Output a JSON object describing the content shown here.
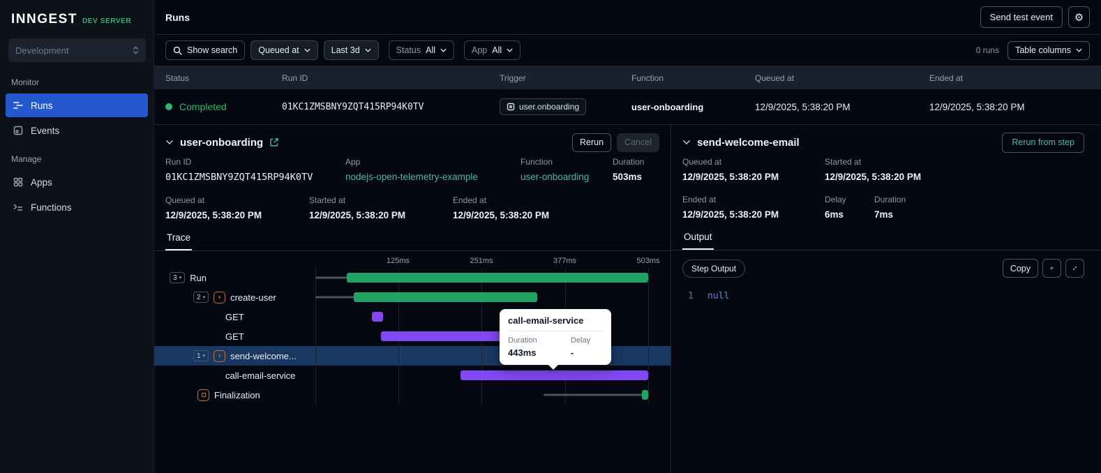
{
  "colors": {
    "green": "#2FB573",
    "bar_green": "#1FA463",
    "purple": "#8147F0",
    "teal": "#4CB7AA",
    "blue": "#2558CC",
    "selected_row": "#183761",
    "orange": "#C9722E"
  },
  "sidebar": {
    "logo": "INNGEST",
    "logo_badge": "DEV SERVER",
    "env_selector": "Development",
    "section_monitor": "Monitor",
    "section_manage": "Manage",
    "item_runs": "Runs",
    "item_events": "Events",
    "item_apps": "Apps",
    "item_functions": "Functions"
  },
  "header": {
    "title": "Runs",
    "send_test_event": "Send test event"
  },
  "filters": {
    "show_search": "Show search",
    "queued_at": "Queued at",
    "time_range": "Last 3d",
    "status_label": "Status",
    "status_value": "All",
    "app_label": "App",
    "app_value": "All",
    "runs_count": "0 runs",
    "table_columns": "Table columns"
  },
  "table": {
    "columns": [
      "Status",
      "Run ID",
      "Trigger",
      "Function",
      "Queued at",
      "Ended at"
    ],
    "row": {
      "status": "Completed",
      "run_id": "01KC1ZMSBNY9ZQT415RP94K0TV",
      "trigger": "user.onboarding",
      "function": "user-onboarding",
      "queued_at": "12/9/2025, 5:38:20 PM",
      "ended_at": "12/9/2025, 5:38:20 PM"
    }
  },
  "run_panel": {
    "title": "user-onboarding",
    "rerun": "Rerun",
    "cancel": "Cancel",
    "run_id_label": "Run ID",
    "run_id": "01KC1ZMSBNY9ZQT415RP94K0TV",
    "app_label": "App",
    "app": "nodejs-open-telemetry-example",
    "function_label": "Function",
    "function": "user-onboarding",
    "duration_label": "Duration",
    "duration": "503ms",
    "queued_label": "Queued at",
    "queued": "12/9/2025, 5:38:20 PM",
    "started_label": "Started at",
    "started": "12/9/2025, 5:38:20 PM",
    "ended_label": "Ended at",
    "ended": "12/9/2025, 5:38:20 PM",
    "tab_trace": "Trace"
  },
  "trace": {
    "total_ms": 503,
    "ticks": [
      {
        "label": "125ms",
        "ms": 125
      },
      {
        "label": "251ms",
        "ms": 251
      },
      {
        "label": "377ms",
        "ms": 377
      },
      {
        "label": "503ms",
        "ms": 503
      }
    ],
    "rows": [
      {
        "name": "Run",
        "badge": "3",
        "pad": 22,
        "wait": [
          0,
          49
        ],
        "span": [
          47,
          503
        ],
        "color": "green"
      },
      {
        "name": "create-user",
        "badge": "2",
        "icon": "step",
        "pad": 56,
        "wait": [
          0,
          60
        ],
        "span": [
          58,
          335
        ],
        "color": "green"
      },
      {
        "name": "GET",
        "pad": 102,
        "span": [
          85,
          102
        ],
        "color": "purple"
      },
      {
        "name": "GET",
        "pad": 102,
        "span": [
          99,
          309
        ],
        "color": "purple"
      },
      {
        "name": "send-welcome...",
        "badge": "1",
        "icon": "step",
        "pad": 56,
        "selected": true
      },
      {
        "name": "call-email-service",
        "pad": 102,
        "span": [
          219,
          503
        ],
        "color": "purple"
      },
      {
        "name": "Finalization",
        "icon": "finalization",
        "pad": 62,
        "wait": [
          345,
          498
        ],
        "span": [
          494,
          503
        ],
        "color": "green"
      }
    ]
  },
  "tooltip": {
    "title": "call-email-service",
    "duration_label": "Duration",
    "duration": "443ms",
    "delay_label": "Delay",
    "delay": "-"
  },
  "step_panel": {
    "title": "send-welcome-email",
    "rerun_from_step": "Rerun from step",
    "queued_label": "Queued at",
    "queued": "12/9/2025, 5:38:20 PM",
    "started_label": "Started at",
    "started": "12/9/2025, 5:38:20 PM",
    "ended_label": "Ended at",
    "ended": "12/9/2025, 5:38:20 PM",
    "delay_label": "Delay",
    "delay": "6ms",
    "duration_label": "Duration",
    "duration": "7ms",
    "tab_output": "Output",
    "step_output_badge": "Step Output",
    "copy": "Copy",
    "code_line": "1",
    "code_value": "null"
  }
}
